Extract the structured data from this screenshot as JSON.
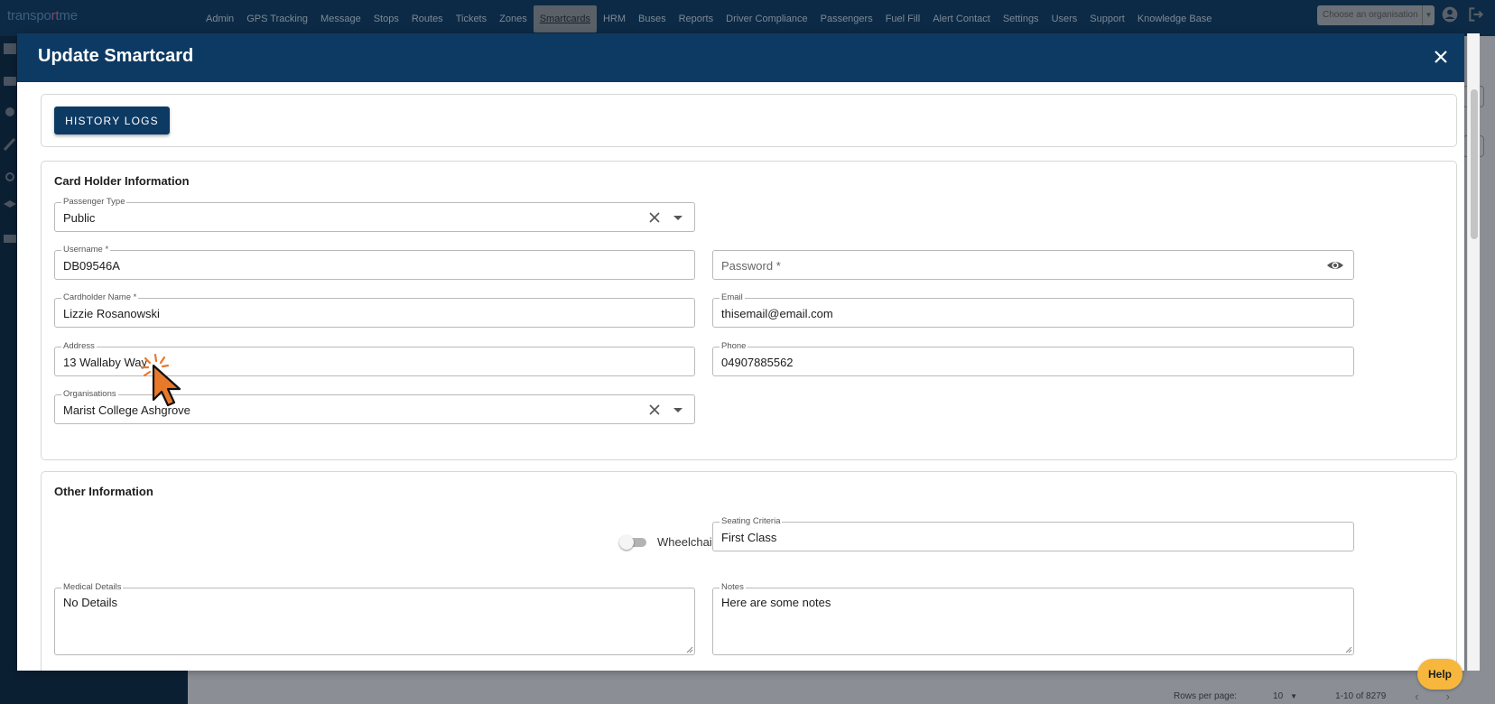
{
  "app": {
    "logo_part1": "transpo",
    "logo_hl": "rt",
    "logo_part2": "me"
  },
  "nav": {
    "items": [
      "Admin",
      "GPS Tracking",
      "Message",
      "Stops",
      "Routes",
      "Tickets",
      "Zones",
      "Smartcards",
      "HRM",
      "Buses",
      "Reports",
      "Driver Compliance",
      "Passengers",
      "Fuel Fill",
      "Alert Contact",
      "Settings",
      "Users",
      "Support",
      "Knowledge Base"
    ],
    "active": "Smartcards",
    "org_placeholder": "Choose an organisation"
  },
  "pager": {
    "rows_label": "Rows per page:",
    "rows_value": "10",
    "range": "1-10 of 8279"
  },
  "modal": {
    "title": "Update Smartcard",
    "history_button": "HISTORY LOGS",
    "cardholder_section": {
      "title": "Card Holder Information",
      "passenger_type": {
        "label": "Passenger Type",
        "value": "Public"
      },
      "username": {
        "label": "Username *",
        "value": "DB09546A"
      },
      "password": {
        "placeholder": "Password *"
      },
      "cardholder_name": {
        "label": "Cardholder Name *",
        "value": "Lizzie Rosanowski"
      },
      "email": {
        "label": "Email",
        "value": "thisemail@email.com"
      },
      "address": {
        "label": "Address",
        "value": "13 Wallaby Way"
      },
      "phone": {
        "label": "Phone",
        "value": "04907885562"
      },
      "organisations": {
        "label": "Organisations",
        "value": "Marist College Ashgrove"
      }
    },
    "other_section": {
      "title": "Other Information",
      "wheelchair": {
        "label": "Wheelchair",
        "checked": false
      },
      "seating_criteria": {
        "label": "Seating Criteria",
        "value": "First Class"
      },
      "medical_details": {
        "label": "Medical Details",
        "value": "No Details"
      },
      "notes": {
        "label": "Notes",
        "value": "Here are some notes"
      }
    }
  },
  "help": {
    "label": "Help"
  },
  "colors": {
    "header_bg": "#0d3a63",
    "button_bg": "#0d3a63",
    "help_bg": "#f6b73c",
    "cursor": "#e8792b"
  },
  "icons": {
    "close": "close-icon",
    "clear": "clear-icon",
    "dropdown": "dropdown-arrow-icon",
    "visibility": "eye-icon",
    "account": "account-circle-icon",
    "logout": "logout-icon"
  }
}
